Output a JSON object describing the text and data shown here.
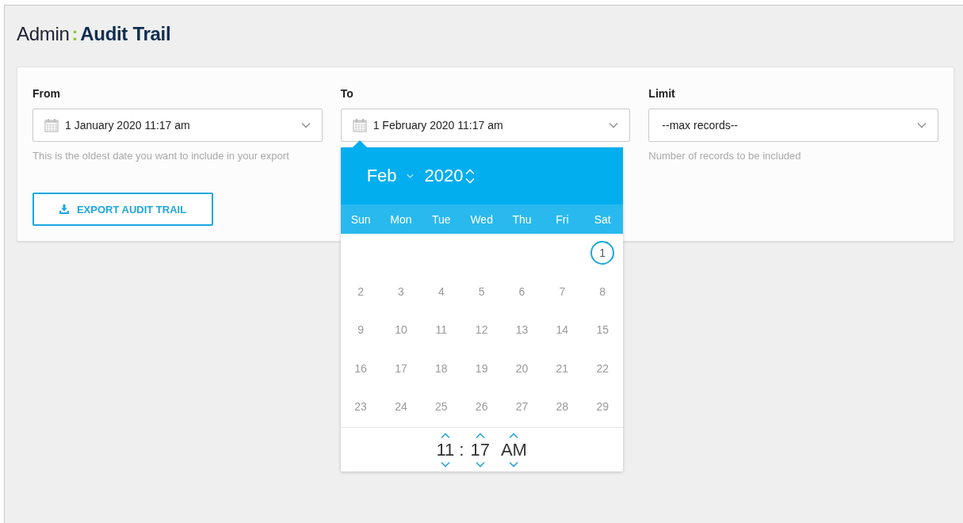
{
  "page_title": {
    "section": "Admin",
    "separator": ":",
    "title": "Audit Trail"
  },
  "filters": [
    {
      "label": "From",
      "value": "1 January 2020 11:17 am",
      "kind": "date",
      "help": "This is the oldest date you want to include in your export",
      "open": false
    },
    {
      "label": "To",
      "value": "1 February 2020 11:17 am",
      "kind": "date",
      "open": true
    },
    {
      "label": "Limit",
      "value": "--max records--",
      "kind": "select",
      "help": "Number of records to be included",
      "open": false
    }
  ],
  "export_button": {
    "label": "EXPORT AUDIT TRAIL"
  },
  "date_picker": {
    "month": "Feb",
    "year": "2020",
    "weekdays": [
      "Sun",
      "Mon",
      "Tue",
      "Wed",
      "Thu",
      "Fri",
      "Sat"
    ],
    "weeks": [
      [
        {
          "kind": "blank"
        },
        {
          "kind": "blank"
        },
        {
          "kind": "blank"
        },
        {
          "kind": "blank"
        },
        {
          "kind": "blank"
        },
        {
          "kind": "blank"
        },
        {
          "kind": "day",
          "day": "1",
          "selected": true
        }
      ],
      [
        {
          "kind": "day",
          "day": "2",
          "selected": false
        },
        {
          "kind": "day",
          "day": "3",
          "selected": false
        },
        {
          "kind": "day",
          "day": "4",
          "selected": false
        },
        {
          "kind": "day",
          "day": "5",
          "selected": false
        },
        {
          "kind": "day",
          "day": "6",
          "selected": false
        },
        {
          "kind": "day",
          "day": "7",
          "selected": false
        },
        {
          "kind": "day",
          "day": "8",
          "selected": false
        }
      ],
      [
        {
          "kind": "day",
          "day": "9",
          "selected": false
        },
        {
          "kind": "day",
          "day": "10",
          "selected": false
        },
        {
          "kind": "day",
          "day": "11",
          "selected": false
        },
        {
          "kind": "day",
          "day": "12",
          "selected": false
        },
        {
          "kind": "day",
          "day": "13",
          "selected": false
        },
        {
          "kind": "day",
          "day": "14",
          "selected": false
        },
        {
          "kind": "day",
          "day": "15",
          "selected": false
        }
      ],
      [
        {
          "kind": "day",
          "day": "16",
          "selected": false
        },
        {
          "kind": "day",
          "day": "17",
          "selected": false
        },
        {
          "kind": "day",
          "day": "18",
          "selected": false
        },
        {
          "kind": "day",
          "day": "19",
          "selected": false
        },
        {
          "kind": "day",
          "day": "20",
          "selected": false
        },
        {
          "kind": "day",
          "day": "21",
          "selected": false
        },
        {
          "kind": "day",
          "day": "22",
          "selected": false
        }
      ],
      [
        {
          "kind": "day",
          "day": "23",
          "selected": false
        },
        {
          "kind": "day",
          "day": "24",
          "selected": false
        },
        {
          "kind": "day",
          "day": "25",
          "selected": false
        },
        {
          "kind": "day",
          "day": "26",
          "selected": false
        },
        {
          "kind": "day",
          "day": "27",
          "selected": false
        },
        {
          "kind": "day",
          "day": "28",
          "selected": false
        },
        {
          "kind": "day",
          "day": "29",
          "selected": false
        }
      ]
    ],
    "time": {
      "hour": "11",
      "separator": ":",
      "minute": "17",
      "period": "AM"
    }
  }
}
